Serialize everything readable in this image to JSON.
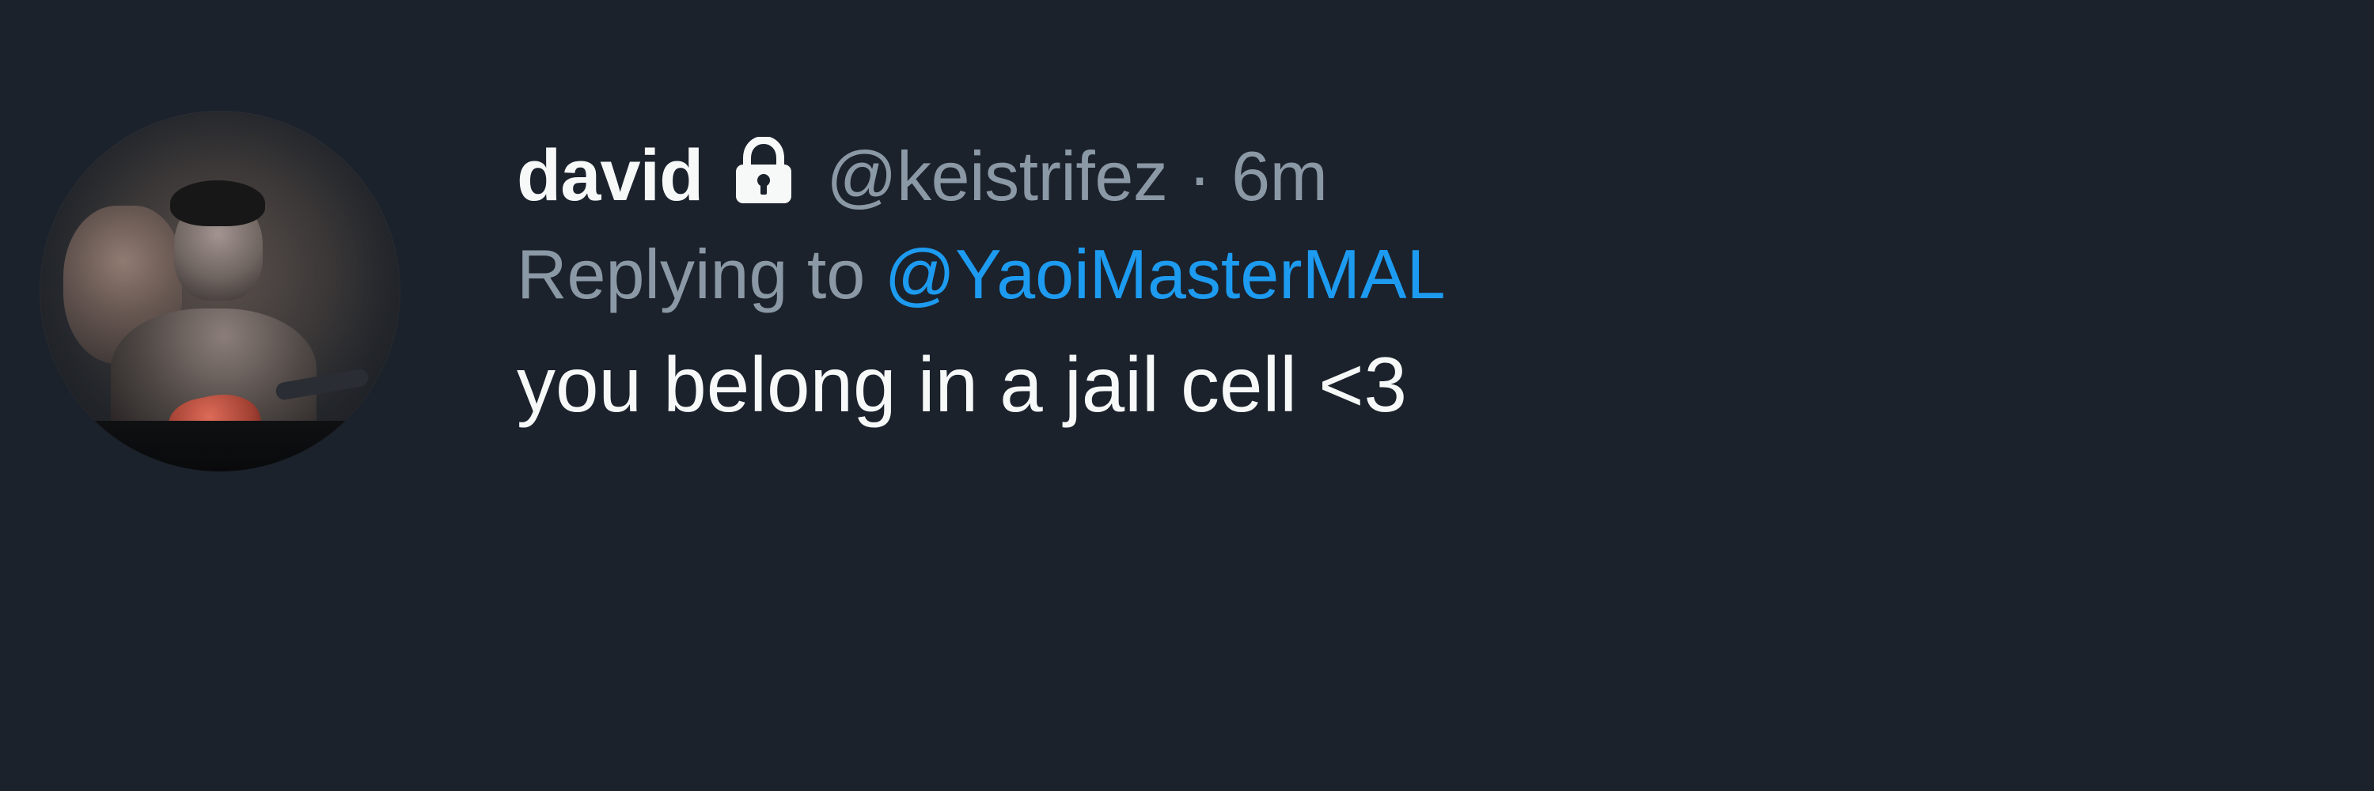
{
  "tweet": {
    "author": {
      "display_name": "david",
      "handle": "@keistrifez",
      "time": "6m",
      "avatar_icon": "profile-photo-icon",
      "lock_icon": "lock-icon"
    },
    "reply": {
      "prefix": "Replying to",
      "target": "@YaoiMasterMAL"
    },
    "text": "you belong in a jail cell <3"
  },
  "theme": {
    "background": "#1b222c",
    "primary_text": "#f7f9f9",
    "secondary_text": "#8b98a5",
    "link": "#1d9bf0"
  }
}
